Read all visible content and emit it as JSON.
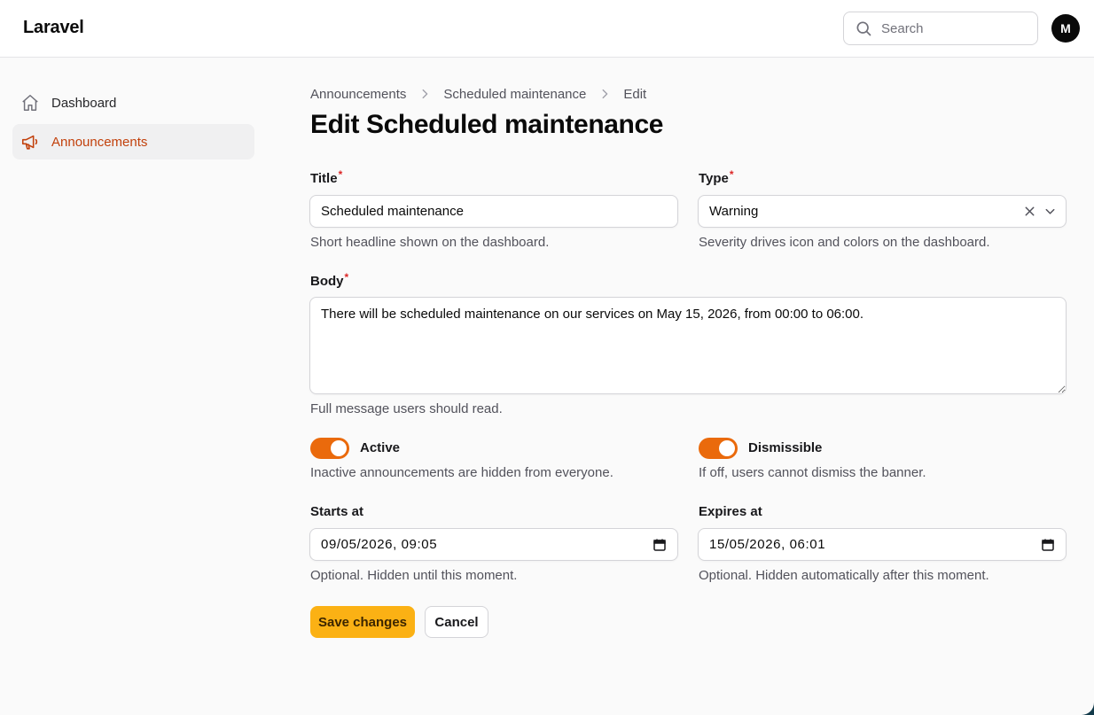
{
  "header": {
    "brand": "Laravel",
    "search_placeholder": "Search",
    "avatar_initial": "M"
  },
  "sidebar": {
    "items": [
      {
        "label": "Dashboard",
        "icon": "home-icon",
        "active": false
      },
      {
        "label": "Announcements",
        "icon": "megaphone-icon",
        "active": true
      }
    ]
  },
  "breadcrumb": [
    "Announcements",
    "Scheduled maintenance",
    "Edit"
  ],
  "page_title": "Edit Scheduled maintenance",
  "form": {
    "title": {
      "label": "Title",
      "required_mark": "*",
      "value": "Scheduled maintenance",
      "hint": "Short headline shown on the dashboard."
    },
    "type": {
      "label": "Type",
      "required_mark": "*",
      "value": "Warning",
      "hint": "Severity drives icon and colors on the dashboard."
    },
    "body": {
      "label": "Body",
      "required_mark": "*",
      "value": "There will be scheduled maintenance on our services on May 15, 2026, from 00:00 to 06:00.",
      "hint": "Full message users should read."
    },
    "active": {
      "label": "Active",
      "on": true,
      "hint": "Inactive announcements are hidden from everyone."
    },
    "dismissible": {
      "label": "Dismissible",
      "on": true,
      "hint": "If off, users cannot dismiss the banner."
    },
    "starts_at": {
      "label": "Starts at",
      "value": "09/05/2026, 09:05",
      "hint": "Optional. Hidden until this moment."
    },
    "expires_at": {
      "label": "Expires at",
      "value": "15/05/2026, 06:01",
      "hint": "Optional. Hidden automatically after this moment."
    }
  },
  "actions": {
    "save_label": "Save changes",
    "cancel_label": "Cancel"
  },
  "colors": {
    "accent": "#ea6a0c",
    "primary_button": "#fbb114",
    "active_nav_text": "#c2410c",
    "required": "#dc2626"
  }
}
